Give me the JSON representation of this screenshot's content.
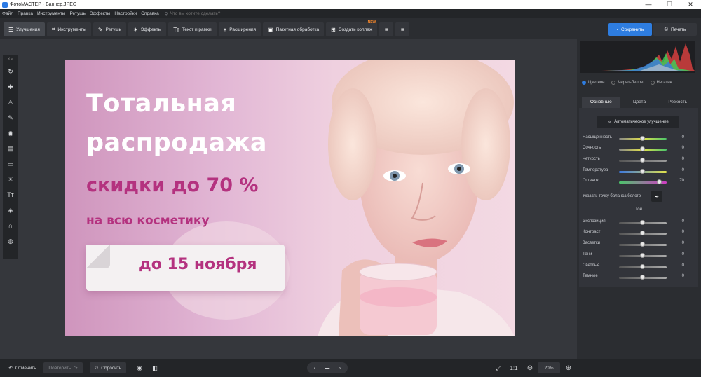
{
  "window": {
    "title": "ФотоМАСТЕР - Баннер.JPEG",
    "minimize": "—",
    "maximize": "☐",
    "close": "✕"
  },
  "menu": {
    "items": [
      "Файл",
      "Правка",
      "Инструменты",
      "Ретушь",
      "Эффекты",
      "Настройки",
      "Справка"
    ],
    "search_placeholder": "Что вы хотите сделать?"
  },
  "toolbar": {
    "tabs": [
      "Улучшения",
      "Инструменты",
      "Ретушь",
      "Эффекты",
      "Текст и рамки",
      "Расширения"
    ],
    "batch": "Пакетная обработка",
    "collage": "Создать коллаж",
    "new_badge": "NEW",
    "save": "Сохранить",
    "print": "Печать"
  },
  "tools": {
    "header": "× «"
  },
  "banner": {
    "line1": "Тотальная",
    "line2": "распродажа",
    "line3": "скидки до 70 %",
    "line4": "на всю косметику",
    "date": "до 15 ноября"
  },
  "panel": {
    "modes": [
      "Цветное",
      "Черно-белое",
      "Негатив"
    ],
    "tabs": [
      "Основные",
      "Цвета",
      "Резкость"
    ],
    "auto": "Автоматическое улучшение",
    "sliders": [
      {
        "label": "Насыщенность",
        "value": "0",
        "pos": 0.5
      },
      {
        "label": "Сочность",
        "value": "0",
        "pos": 0.5
      },
      {
        "label": "Четкость",
        "value": "0",
        "pos": 0.5
      },
      {
        "label": "Температура",
        "value": "0",
        "pos": 0.5
      },
      {
        "label": "Оттенок",
        "value": "70",
        "pos": 0.85
      }
    ],
    "white_balance": "Указать точку баланса белого",
    "tone_header": "Тон",
    "tone": [
      {
        "label": "Экспозиция",
        "value": "0",
        "pos": 0.5
      },
      {
        "label": "Контраст",
        "value": "0",
        "pos": 0.5
      },
      {
        "label": "Засветки",
        "value": "0",
        "pos": 0.5
      },
      {
        "label": "Тени",
        "value": "0",
        "pos": 0.5
      },
      {
        "label": "Светлые",
        "value": "0",
        "pos": 0.5
      },
      {
        "label": "Темные",
        "value": "0",
        "pos": 0.5
      }
    ]
  },
  "bottom": {
    "undo": "Отменить",
    "redo": "Повторить",
    "reset": "Сбросить",
    "ratio": "1:1",
    "zoom": "20%"
  }
}
